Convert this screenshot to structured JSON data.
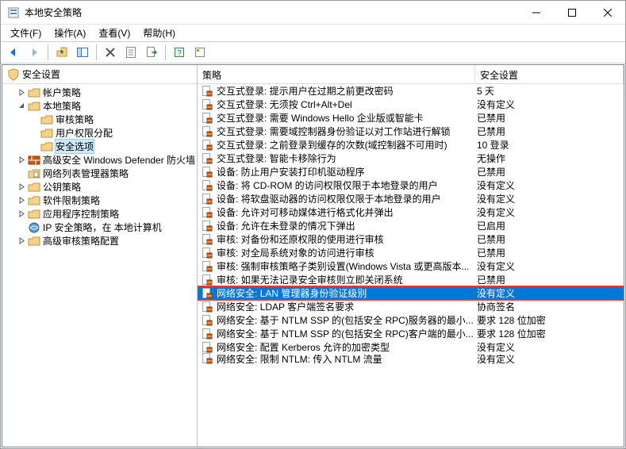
{
  "window": {
    "title": "本地安全策略"
  },
  "menu": {
    "file": "文件(F)",
    "action": "操作(A)",
    "view": "查看(V)",
    "help": "帮助(H)"
  },
  "tree": {
    "header": "安全设置",
    "root": "安全设置",
    "items": [
      {
        "label": "帐户策略",
        "depth": 2,
        "expandable": true,
        "expanded": false,
        "icon": "folder"
      },
      {
        "label": "本地策略",
        "depth": 2,
        "expandable": true,
        "expanded": true,
        "icon": "folder"
      },
      {
        "label": "审核策略",
        "depth": 3,
        "expandable": false,
        "icon": "folder"
      },
      {
        "label": "用户权限分配",
        "depth": 3,
        "expandable": false,
        "icon": "folder"
      },
      {
        "label": "安全选项",
        "depth": 3,
        "expandable": false,
        "icon": "folder",
        "selected": true
      },
      {
        "label": "高级安全 Windows Defender 防火墙",
        "depth": 2,
        "expandable": true,
        "expanded": false,
        "icon": "firewall"
      },
      {
        "label": "网络列表管理器策略",
        "depth": 2,
        "expandable": false,
        "icon": "folder-doc"
      },
      {
        "label": "公钥策略",
        "depth": 2,
        "expandable": true,
        "expanded": false,
        "icon": "folder"
      },
      {
        "label": "软件限制策略",
        "depth": 2,
        "expandable": true,
        "expanded": false,
        "icon": "folder"
      },
      {
        "label": "应用程序控制策略",
        "depth": 2,
        "expandable": true,
        "expanded": false,
        "icon": "folder"
      },
      {
        "label": "IP 安全策略，在 本地计算机",
        "depth": 2,
        "expandable": false,
        "icon": "ipsec"
      },
      {
        "label": "高级审核策略配置",
        "depth": 2,
        "expandable": true,
        "expanded": false,
        "icon": "folder"
      }
    ]
  },
  "list": {
    "columns": {
      "policy": "策略",
      "setting": "安全设置"
    },
    "rows": [
      {
        "policy": "交互式登录: 提示用户在过期之前更改密码",
        "setting": "5 天"
      },
      {
        "policy": "交互式登录: 无须按 Ctrl+Alt+Del",
        "setting": "没有定义"
      },
      {
        "policy": "交互式登录: 需要 Windows Hello 企业版或智能卡",
        "setting": "已禁用"
      },
      {
        "policy": "交互式登录: 需要域控制器身份验证以对工作站进行解锁",
        "setting": "已禁用"
      },
      {
        "policy": "交互式登录: 之前登录到缓存的次数(域控制器不可用时)",
        "setting": "10 登录"
      },
      {
        "policy": "交互式登录: 智能卡移除行为",
        "setting": "无操作"
      },
      {
        "policy": "设备: 防止用户安装打印机驱动程序",
        "setting": "已禁用"
      },
      {
        "policy": "设备: 将 CD-ROM 的访问权限仅限于本地登录的用户",
        "setting": "没有定义"
      },
      {
        "policy": "设备: 将软盘驱动器的访问权限仅限于本地登录的用户",
        "setting": "没有定义"
      },
      {
        "policy": "设备: 允许对可移动媒体进行格式化并弹出",
        "setting": "没有定义"
      },
      {
        "policy": "设备: 允许在未登录的情况下弹出",
        "setting": "已启用"
      },
      {
        "policy": "审核: 对备份和还原权限的使用进行审核",
        "setting": "已禁用"
      },
      {
        "policy": "审核: 对全局系统对象的访问进行审核",
        "setting": "已禁用"
      },
      {
        "policy": "审核: 强制审核策略子类别设置(Windows Vista 或更高版本...",
        "setting": "没有定义"
      },
      {
        "policy": "审核: 如果无法记录安全审核则立即关闭系统",
        "setting": "已禁用"
      },
      {
        "policy": "网络安全: LAN 管理器身份验证级别",
        "setting": "没有定义",
        "selected": true,
        "highlighted": true
      },
      {
        "policy": "网络安全: LDAP 客户端签名要求",
        "setting": "协商签名"
      },
      {
        "policy": "网络安全: 基于 NTLM SSP 的(包括安全 RPC)服务器的最小...",
        "setting": "要求 128 位加密"
      },
      {
        "policy": "网络安全: 基于 NTLM SSP 的(包括安全 RPC)客户端的最小...",
        "setting": "要求 128 位加密"
      },
      {
        "policy": "网络安全: 配置 Kerberos 允许的加密类型",
        "setting": "没有定义"
      },
      {
        "policy": "网络安全: 限制 NTLM: 传入 NTLM 流量",
        "setting": "没有定义",
        "partial": true
      }
    ]
  }
}
